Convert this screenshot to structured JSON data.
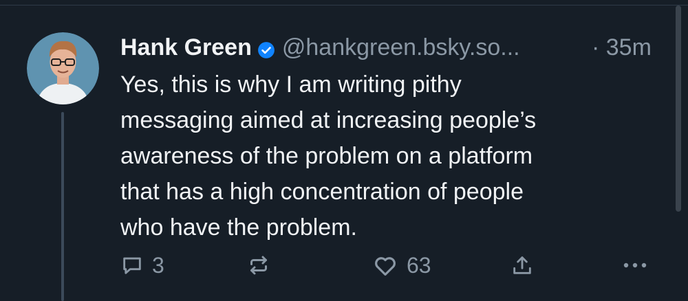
{
  "post": {
    "author": "Hank Green",
    "handle": "@hankgreen.bsky.so...",
    "timestamp": "· 35m",
    "text_lines": [
      "Yes, this is why I am writing pithy",
      "messaging aimed at increasing people’s",
      "awareness of the problem on a platform",
      "that has a high concentration of people",
      "who have the problem."
    ],
    "verified": true
  },
  "actions": {
    "reply_count": "3",
    "like_count": "63"
  },
  "colors": {
    "background": "#161e27",
    "text": "#f1f3f5",
    "muted": "#8b98a5",
    "verified": "#1083fe"
  }
}
